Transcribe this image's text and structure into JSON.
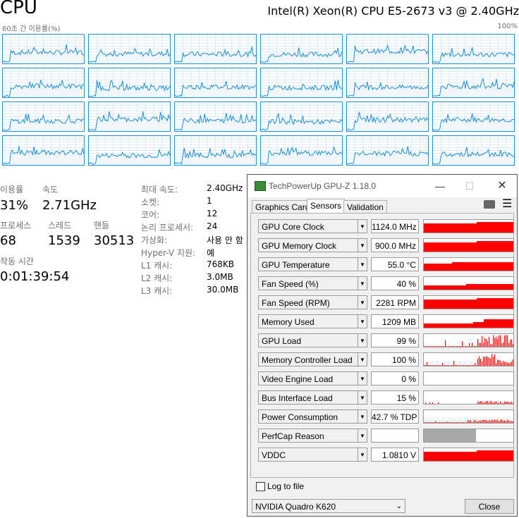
{
  "taskmgr": {
    "title": "CPU",
    "model": "Intel(R) Xeon(R) CPU E5-2673 v3 @ 2.40GHz",
    "graph_label": "60초 간 이용률(%)",
    "graph_max": "100%",
    "stats": {
      "util_label": "이용률",
      "util_value": "31%",
      "speed_label": "속도",
      "speed_value": "2.71GHz",
      "proc_label": "프로세스",
      "proc_value": "68",
      "thread_label": "스레드",
      "thread_value": "1539",
      "handle_label": "핸들",
      "handle_value": "30513",
      "uptime_label": "작동 시간",
      "uptime_value": "0:01:39:54"
    },
    "specs": [
      {
        "k": "최대 속도:",
        "v": "2.40GHz"
      },
      {
        "k": "소켓:",
        "v": "1"
      },
      {
        "k": "코어:",
        "v": "12"
      },
      {
        "k": "논리 프로세서:",
        "v": "24"
      },
      {
        "k": "가상화:",
        "v": "사용 안 함"
      },
      {
        "k": "Hyper-V 지원:",
        "v": "예"
      },
      {
        "k": "L1 캐시:",
        "v": "768KB"
      },
      {
        "k": "L2 캐시:",
        "v": "3.0MB"
      },
      {
        "k": "L3 캐시:",
        "v": "30.0MB"
      }
    ]
  },
  "gpuz": {
    "title": "TechPowerUp GPU-Z 1.18.0",
    "tabs": [
      "Graphics Card",
      "Sensors",
      "Validation"
    ],
    "active_tab": "Sensors",
    "sensors": [
      {
        "name": "GPU Core Clock",
        "value": "1124.0 MHz"
      },
      {
        "name": "GPU Memory Clock",
        "value": "900.0 MHz"
      },
      {
        "name": "GPU Temperature",
        "value": "55.0 °C"
      },
      {
        "name": "Fan Speed (%)",
        "value": "40 %"
      },
      {
        "name": "Fan Speed (RPM)",
        "value": "2281 RPM"
      },
      {
        "name": "Memory Used",
        "value": "1209 MB"
      },
      {
        "name": "GPU Load",
        "value": "99 %"
      },
      {
        "name": "Memory Controller Load",
        "value": "100 %"
      },
      {
        "name": "Video Engine Load",
        "value": "0 %"
      },
      {
        "name": "Bus Interface Load",
        "value": "15 %"
      },
      {
        "name": "Power Consumption",
        "value": "42.7 % TDP"
      },
      {
        "name": "PerfCap Reason",
        "value": ""
      },
      {
        "name": "VDDC",
        "value": "1.0810 V"
      }
    ],
    "log_label": "Log to file",
    "gpu_select": "NVIDIA Quadro K620",
    "close_label": "Close",
    "colors": {
      "graph": "#ff0000",
      "perfcap": "#a8a8a8",
      "cpu_line": "#1c8fd6",
      "cpu_fill": "#f1f6fa"
    }
  }
}
